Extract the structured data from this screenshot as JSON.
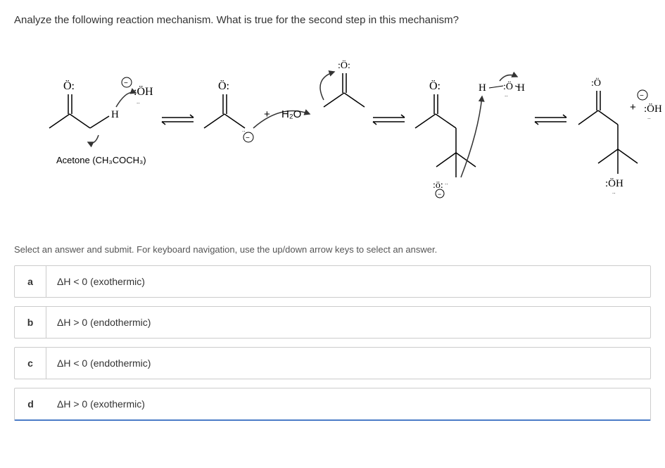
{
  "question": "Analyze the following reaction mechanism. What is true for the second step in this mechanism?",
  "diagram": {
    "acetone_label": "Acetone (CH₃COCH₃)",
    "reagent_oh": ":ÖH",
    "reagent_h2o": "H₂O",
    "o_lone": "Ö:",
    "o_top": ":Ö:",
    "h_label": "H",
    "o_minus": ":O:",
    "oh_product": ":ÖH",
    "plus": "+",
    "negative": "⊖",
    "hoh_product": ":ÖH"
  },
  "instruction": "Select an answer and submit. For keyboard navigation, use the up/down arrow keys to select an answer.",
  "options": [
    {
      "letter": "a",
      "text": "ΔH < 0 (exothermic)"
    },
    {
      "letter": "b",
      "text": "ΔH > 0 (endothermic)"
    },
    {
      "letter": "c",
      "text": "ΔH < 0 (endothermic)"
    },
    {
      "letter": "d",
      "text": "ΔH > 0 (exothermic)"
    }
  ]
}
